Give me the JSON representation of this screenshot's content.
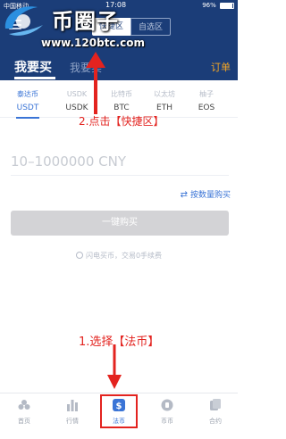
{
  "status_bar": {
    "carrier": "中国移动",
    "time": "17:08",
    "battery": "96%",
    "battery_level": 0.96
  },
  "header": {
    "segments": [
      "快捷区",
      "自选区"
    ],
    "buy_tab": "我要买",
    "sell_tab": "我要卖",
    "orders_label": "订单"
  },
  "watermark": {
    "title": "币圈子",
    "url": "www.120btc.com"
  },
  "coins": [
    {
      "name_cn": "泰达币",
      "symbol": "USDT"
    },
    {
      "name_cn": "USDK",
      "symbol": "USDK"
    },
    {
      "name_cn": "比特币",
      "symbol": "BTC"
    },
    {
      "name_cn": "以太坊",
      "symbol": "ETH"
    },
    {
      "name_cn": "柚子",
      "symbol": "EOS"
    }
  ],
  "form": {
    "amount_placeholder": "10–1000000 CNY",
    "switch_mode": "按数量购买",
    "buy_button": "一键购买",
    "note": "闪电买币，交易0手续费"
  },
  "annotations": {
    "step1": "1.选择【法币】",
    "step2": "2.点击【快捷区】"
  },
  "nav": [
    {
      "label": "首页",
      "icon": "home-icon"
    },
    {
      "label": "行情",
      "icon": "chart-bars-icon"
    },
    {
      "label": "法币",
      "icon": "dollar-icon"
    },
    {
      "label": "币币",
      "icon": "coin-icon"
    },
    {
      "label": "合约",
      "icon": "contract-icon"
    }
  ],
  "colors": {
    "header_bg": "#1b3d78",
    "accent": "#3a74d6",
    "annotation": "#e3231f",
    "orders": "#f5a623"
  }
}
